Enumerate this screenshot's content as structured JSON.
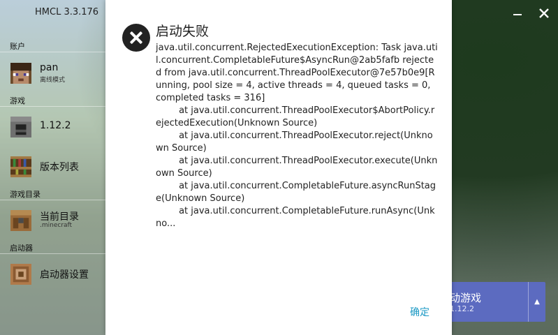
{
  "app": {
    "title": "HMCL 3.3.176"
  },
  "sidebar": {
    "sections": {
      "account": "账户",
      "game": "游戏",
      "game_dir": "游戏目录",
      "launcher": "启动器"
    },
    "account": {
      "name": "pan",
      "mode": "离线模式"
    },
    "game_version": "1.12.2",
    "version_list": "版本列表",
    "current_dir": {
      "label": "当前目录",
      "sub": ".minecraft"
    },
    "launcher_settings": "启动器设置"
  },
  "launch_button": {
    "title": "动游戏",
    "version": "1.12.2"
  },
  "dialog": {
    "title": "启动失败",
    "message": "java.util.concurrent.RejectedExecutionException: Task java.util.concurrent.CompletableFuture$AsyncRun@2ab5fafb rejected from java.util.concurrent.ThreadPoolExecutor@7e57b0e9[Running, pool size = 4, active threads = 4, queued tasks = 0, completed tasks = 316]\n\tat java.util.concurrent.ThreadPoolExecutor$AbortPolicy.rejectedExecution(Unknown Source)\n\tat java.util.concurrent.ThreadPoolExecutor.reject(Unknown Source)\n\tat java.util.concurrent.ThreadPoolExecutor.execute(Unknown Source)\n\tat java.util.concurrent.CompletableFuture.asyncRunStage(Unknown Source)\n\tat java.util.concurrent.CompletableFuture.runAsync(Unkno...",
    "ok_label": "确定"
  },
  "icons": {
    "error": "error-icon",
    "minimize": "minimize-icon",
    "close": "close-icon",
    "expand": "chevron-up-icon"
  },
  "colors": {
    "accent": "#5c6bc0",
    "link": "#1b99c4"
  }
}
